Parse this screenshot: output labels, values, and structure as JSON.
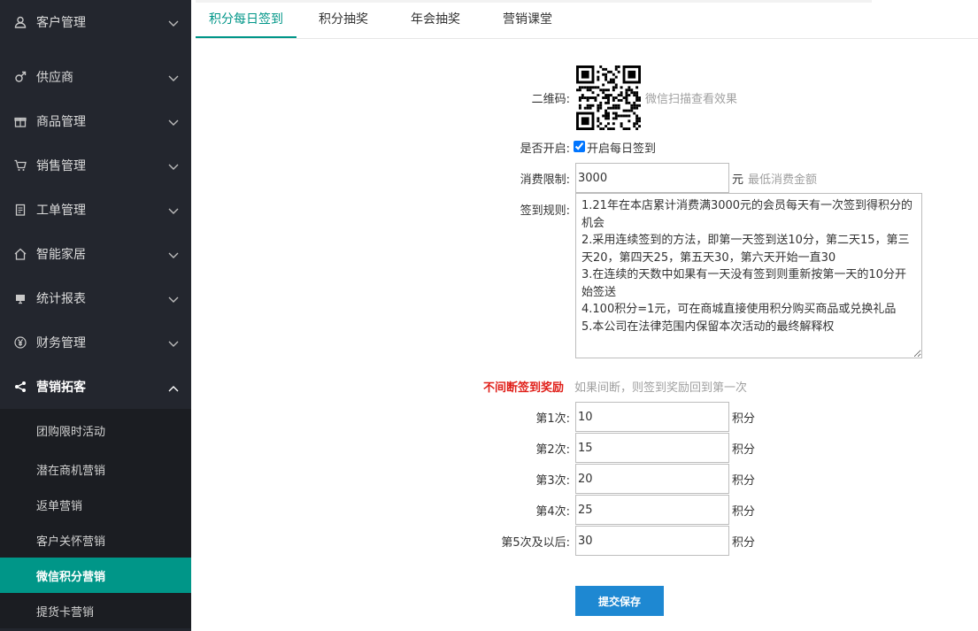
{
  "sidebar": {
    "items": [
      {
        "label": "客户管理",
        "icon": "user-icon"
      },
      {
        "label": "供应商",
        "icon": "male-icon"
      },
      {
        "label": "商品管理",
        "icon": "gift-icon"
      },
      {
        "label": "销售管理",
        "icon": "cart-icon"
      },
      {
        "label": "工单管理",
        "icon": "clipboard-icon"
      },
      {
        "label": "智能家居",
        "icon": "home-icon"
      },
      {
        "label": "统计报表",
        "icon": "monitor-icon"
      },
      {
        "label": "财务管理",
        "icon": "yen-icon"
      },
      {
        "label": "营销拓客",
        "icon": "share-icon"
      }
    ],
    "sub_items": [
      "团购限时活动",
      "潜在商机营销",
      "返单营销",
      "客户关怀营销",
      "微信积分营销",
      "提货卡营销"
    ],
    "active_sub": "微信积分营销"
  },
  "tabs": [
    "积分每日签到",
    "积分抽奖",
    "年会抽奖",
    "营销课堂"
  ],
  "form": {
    "qr_label": "二维码:",
    "qr_hint": "微信扫描查看效果",
    "enable_label": "是否开启:",
    "enable_text": "开启每日签到",
    "enable_checked": true,
    "limit_label": "消费限制:",
    "limit_value": "3000",
    "limit_unit": "元",
    "limit_hint": "最低消费金额",
    "rules_label": "签到规则:",
    "rules_text": "1.21年在本店累计消费满3000元的会员每天有一次签到得积分的机会\n2.采用连续签到的方法，即第一天签到送10分，第二天15，第三天20，第四天25，第五天30，第六天开始一直30\n3.在连续的天数中如果有一天没有签到则重新按第一天的10分开始签送\n4.100积分=1元，可在商城直接使用积分购买商品或兑换礼品\n5.本公司在法律范围内保留本次活动的最终解释权",
    "reward_title": "不间断签到奖励",
    "reward_hint": "如果间断，则签到奖励回到第一次",
    "rewards": [
      {
        "label": "第1次:",
        "value": "10",
        "unit": "积分"
      },
      {
        "label": "第2次:",
        "value": "15",
        "unit": "积分"
      },
      {
        "label": "第3次:",
        "value": "20",
        "unit": "积分"
      },
      {
        "label": "第4次:",
        "value": "25",
        "unit": "积分"
      },
      {
        "label": "第5次及以后:",
        "value": "30",
        "unit": "积分"
      }
    ],
    "submit_label": "提交保存"
  },
  "colors": {
    "sidebar_bg": "#23262e",
    "accent": "#009688",
    "button": "#1e88d2",
    "reward_title": "#e0201a"
  }
}
